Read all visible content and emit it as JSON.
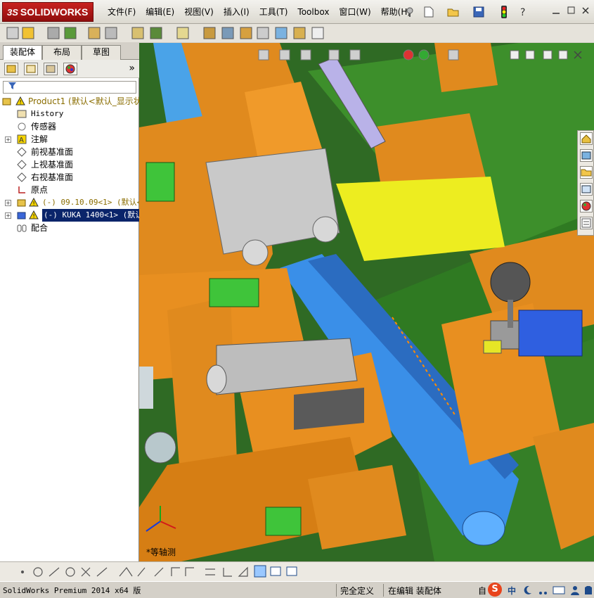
{
  "app": {
    "logo_text": "SOLIDWORKS",
    "logo_prefix": "3S"
  },
  "menu": [
    "文件(F)",
    "编辑(E)",
    "视图(V)",
    "插入(I)",
    "工具(T)",
    "Toolbox",
    "窗口(W)",
    "帮助(H)"
  ],
  "panel_tabs": [
    "装配体",
    "布局",
    "草图"
  ],
  "tree": {
    "root": "Product1  (默认<默认_显示状",
    "items": [
      {
        "label": "History"
      },
      {
        "label": "传感器"
      },
      {
        "label": "注解"
      },
      {
        "label": "前视基准面"
      },
      {
        "label": "上视基准面"
      },
      {
        "label": "右视基准面"
      },
      {
        "label": "原点"
      },
      {
        "label": "(-) 09.10.09<1> (默认<"
      },
      {
        "label": "(-) KUKA 1400<1> (默认<"
      },
      {
        "label": "配合"
      }
    ]
  },
  "expand_all": "»",
  "filter_icon": "funnel-icon",
  "status": {
    "version": "SolidWorks Premium 2014 x64 版",
    "state": "完全定义",
    "editing": "在编辑 装配体",
    "ime_a": "中",
    "ime_b": "自"
  },
  "viewport_label": "*等轴测",
  "colors": {
    "accent_red": "#c8221f",
    "part_orange": "#e08a1e",
    "part_green": "#2e8a2a",
    "part_blue": "#3a8fe8",
    "selection": "#0a246a"
  }
}
